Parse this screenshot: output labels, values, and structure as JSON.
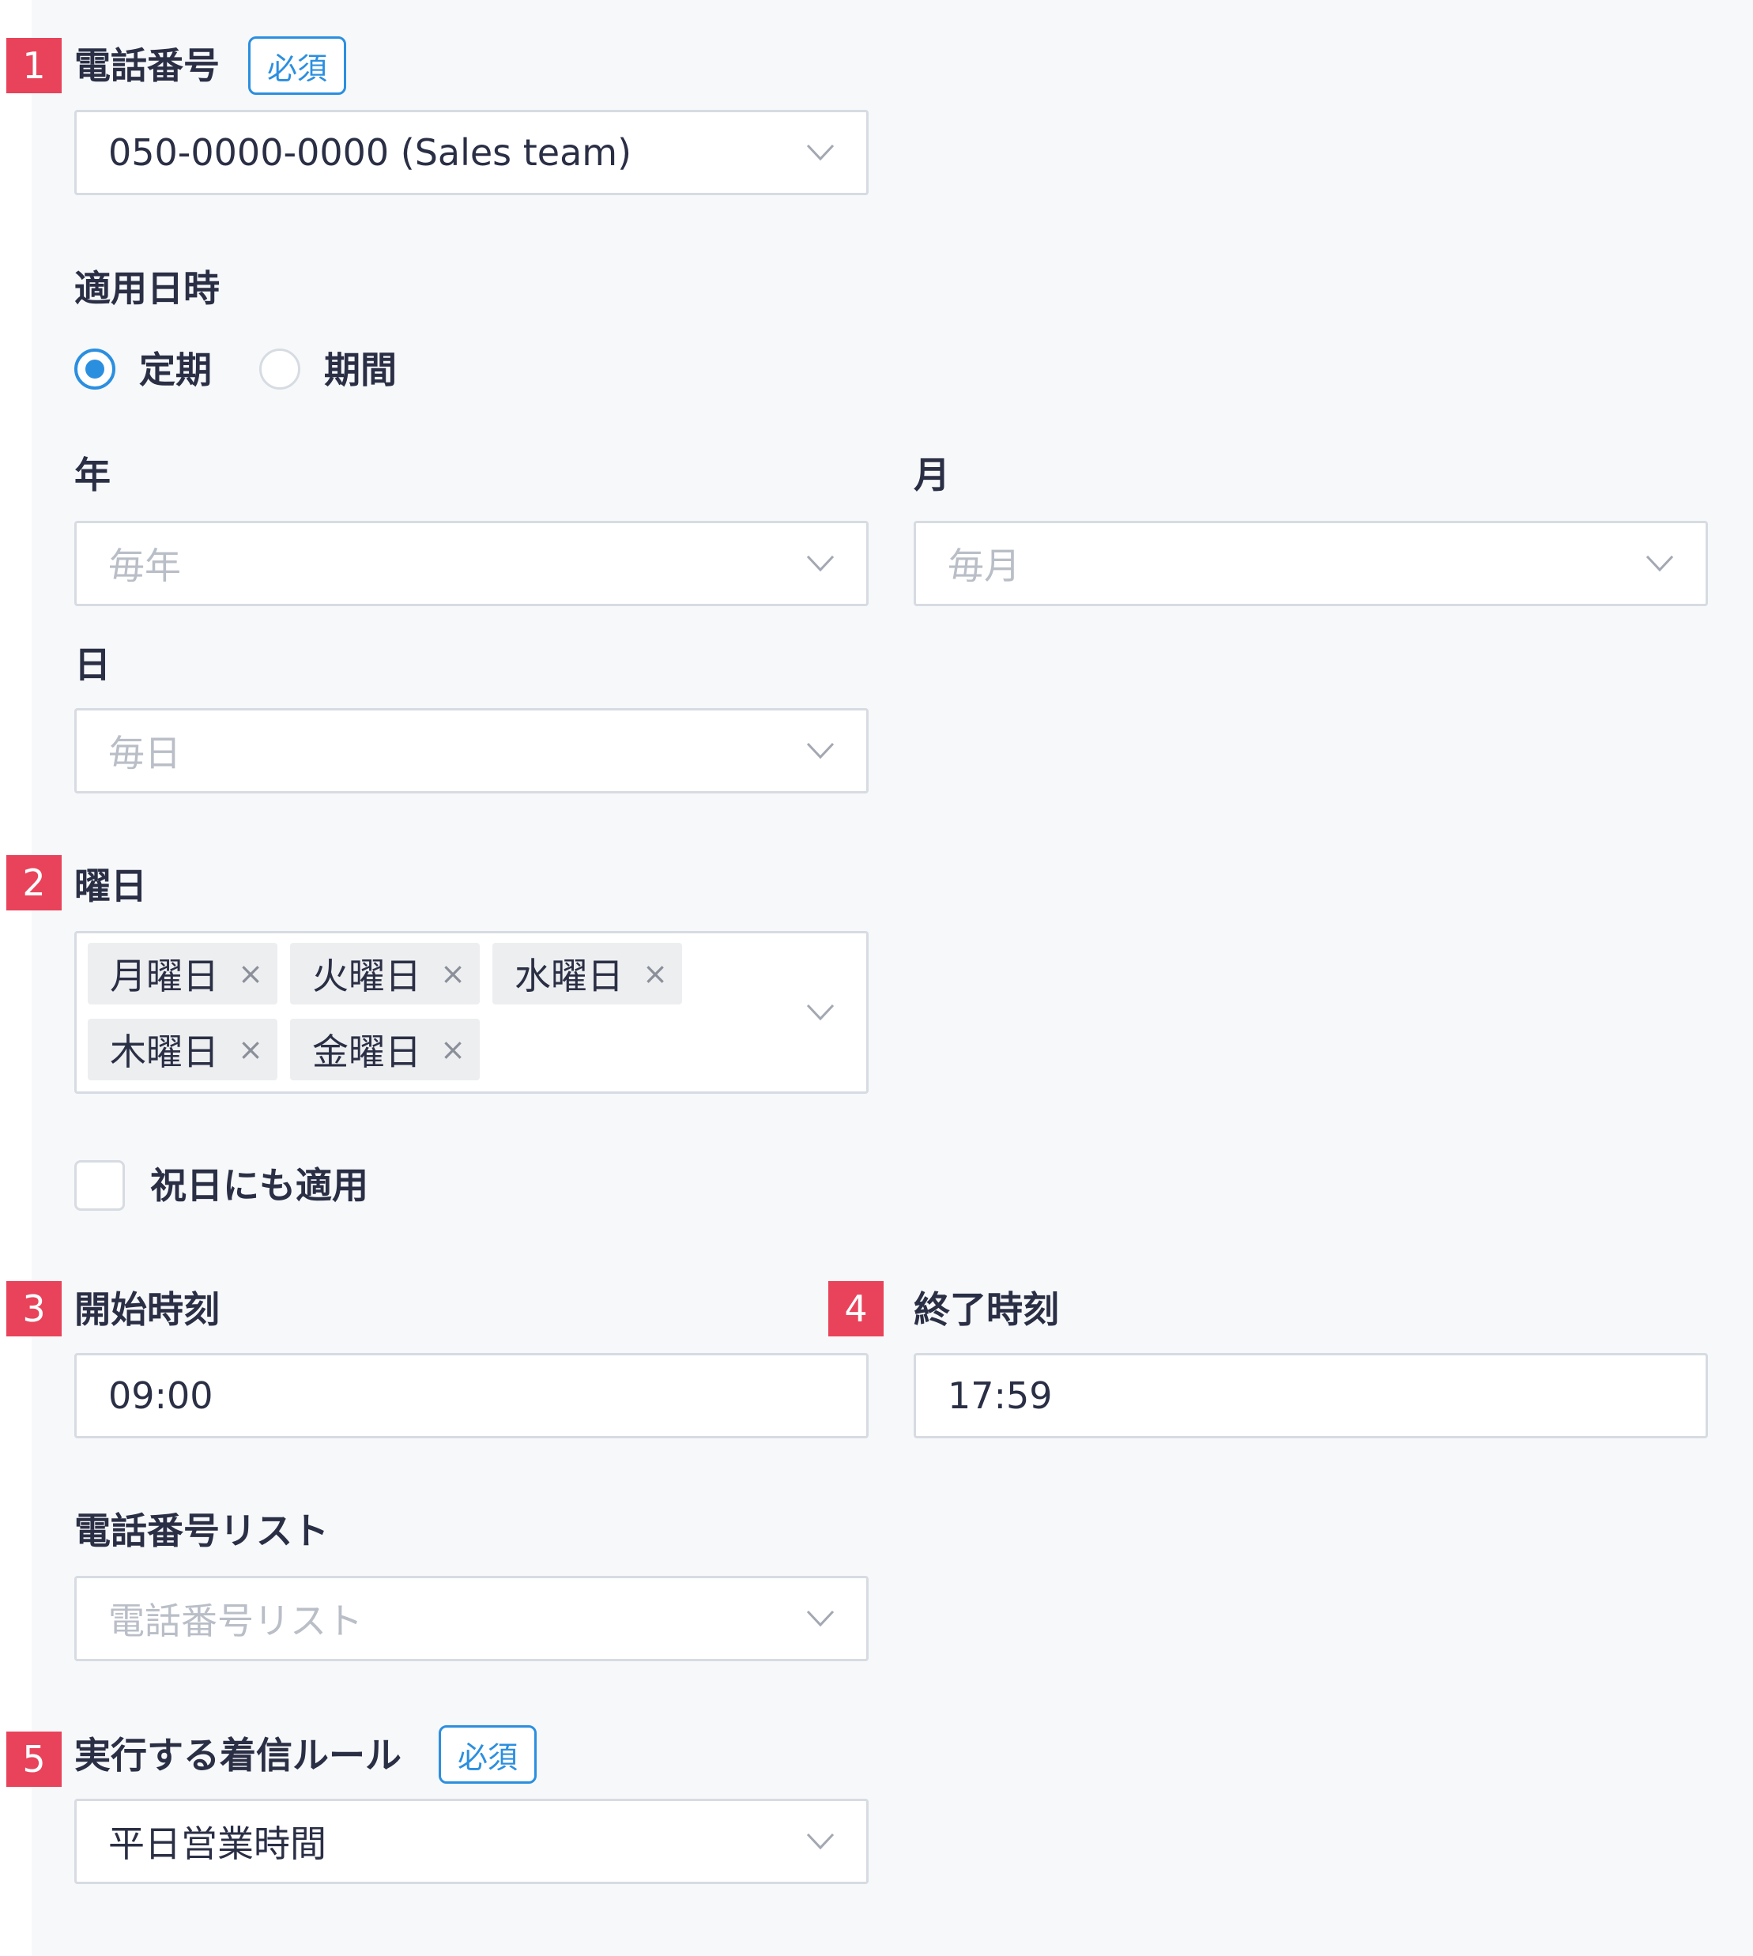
{
  "phone_number": {
    "step": "1",
    "label": "電話番号",
    "required_tag": "必須",
    "value": "050-0000-0000 (Sales team)"
  },
  "schedule": {
    "label": "適用日時",
    "options": [
      {
        "label": "定期",
        "checked": true
      },
      {
        "label": "期間",
        "checked": false
      }
    ]
  },
  "year": {
    "label": "年",
    "placeholder": "毎年"
  },
  "month": {
    "label": "月",
    "placeholder": "毎月"
  },
  "day": {
    "label": "日",
    "placeholder": "毎日"
  },
  "weekday": {
    "step": "2",
    "label": "曜日",
    "selected": [
      "月曜日",
      "火曜日",
      "水曜日",
      "木曜日",
      "金曜日"
    ],
    "remove_icon": "×"
  },
  "holiday": {
    "label": "祝日にも適用",
    "checked": false
  },
  "start_time": {
    "step": "3",
    "label": "開始時刻",
    "value": "09:00"
  },
  "end_time": {
    "step": "4",
    "label": "終了時刻",
    "value": "17:59"
  },
  "phone_list": {
    "label": "電話番号リスト",
    "placeholder": "電話番号リスト"
  },
  "incoming_rule": {
    "step": "5",
    "label": "実行する着信ルール",
    "required_tag": "必須",
    "value": "平日営業時間"
  },
  "colors": {
    "accent": "#2b8fe0",
    "step_badge": "#e8435a",
    "panel_bg": "#f7f8fa",
    "border": "#d7dbe2",
    "placeholder": "#b9bec7",
    "tag_bg": "#edeef0"
  },
  "icons": {
    "dropdown": "chevron-down-icon",
    "remove": "close-icon"
  }
}
